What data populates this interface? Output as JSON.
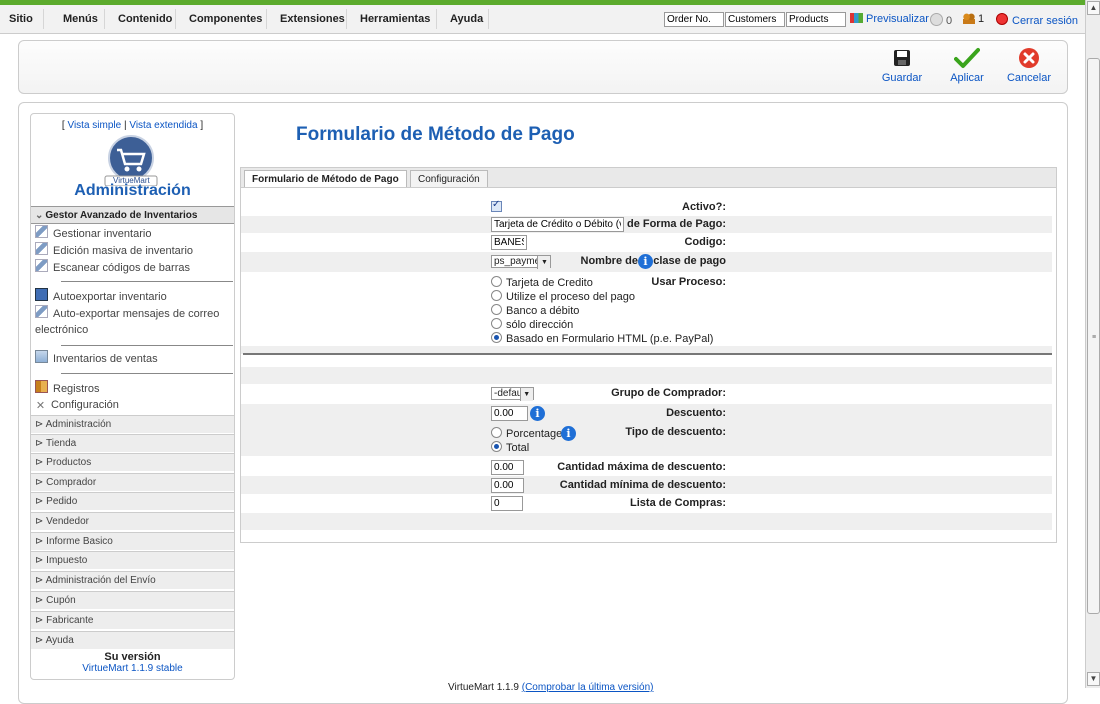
{
  "menu": [
    "Sitio",
    "Menús",
    "Contenido",
    "Componentes",
    "Extensiones",
    "Herramientas",
    "Ayuda"
  ],
  "quick_search": [
    "Order No.",
    "Customers",
    "Products"
  ],
  "status": {
    "preview": "Previsualizar",
    "messages": "0",
    "users": "1",
    "logout": "Cerrar sesión"
  },
  "toolbar": {
    "save": "Guardar",
    "apply": "Aplicar",
    "cancel": "Cancelar"
  },
  "sidebar": {
    "view_simple": "Vista simple",
    "view_extended": "Vista extendida",
    "logo_text": "VirtueMart",
    "title": "Administración",
    "section_header": "Gestor Avanzado de Inventarios",
    "items": [
      "Gestionar inventario",
      "Edición masiva de inventario",
      "Escanear códigos de barras",
      "Autoexportar inventario",
      "Auto-exportar mensajes de correo",
      "electrónico",
      "Inventarios de ventas",
      "Registros",
      "Configuración"
    ],
    "collapsed": [
      "Administración",
      "Tienda",
      "Productos",
      "Comprador",
      "Pedido",
      "Vendedor",
      "Informe Basico",
      "Impuesto",
      "Administración del Envío",
      "Cupón",
      "Fabricante",
      "Ayuda"
    ],
    "version_title": "Su versión",
    "version_value": "VirtueMart 1.1.9 stable"
  },
  "page_title": "Formulario de Método de Pago",
  "tabs": [
    "Formulario de Método de Pago",
    "Configuración"
  ],
  "form": {
    "active_label": "Activo?:",
    "name_label": "Nombre de Forma de Pago:",
    "name_value": "Tarjeta de Crédito o Débito (vía",
    "code_label": "Codigo:",
    "code_value": "BANES",
    "class_label": "Nombre de la clase de pago",
    "class_value": "ps_payment",
    "process_label": "Usar Proceso:",
    "process_options": [
      "Tarjeta de Credito",
      "Utilize el proceso del pago",
      "Banco a débito",
      "sólo dirección",
      "Basado en Formulario HTML (p.e. PayPal)"
    ],
    "group_label": "Grupo de Comprador:",
    "group_value": "-default-",
    "discount_label": "Descuento:",
    "discount_value": "0.00",
    "discount_type_label": "Tipo de descuento:",
    "discount_type_options": [
      "Porcentage",
      "Total"
    ],
    "max_discount_label": "Cantidad máxima de descuento:",
    "max_discount_value": "0.00",
    "min_discount_label": "Cantidad mínima de descuento:",
    "min_discount_value": "0.00",
    "list_label": "Lista de Compras:",
    "list_value": "0"
  },
  "footer": {
    "version": "VirtueMart 1.1.9",
    "link": "(Comprobar la última versión)"
  }
}
